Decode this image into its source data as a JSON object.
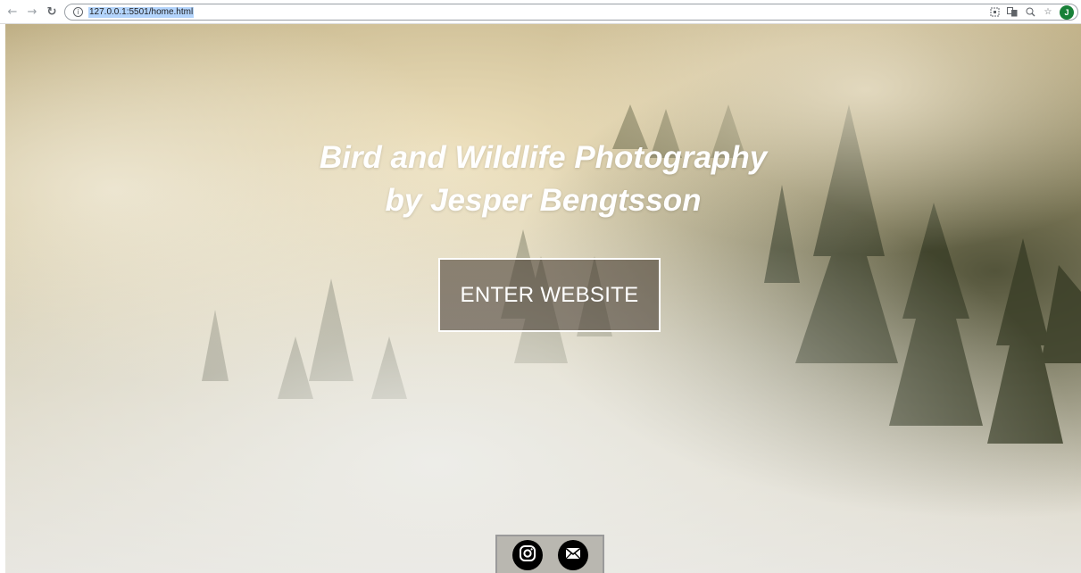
{
  "browser": {
    "url": "127.0.0.1:5501/home.html",
    "avatar_initial": "J"
  },
  "hero": {
    "title_line1": "Bird and Wildlife Photography",
    "title_line2": "by Jesper Bengtsson",
    "enter_label": "ENTER WEBSITE"
  },
  "social": {
    "items": [
      {
        "icon": "instagram-icon"
      },
      {
        "icon": "mail-icon"
      }
    ]
  },
  "colors": {
    "avatar_bg": "#188038",
    "button_border": "#ffffff",
    "social_bar_bg": "#b9b7b0"
  }
}
